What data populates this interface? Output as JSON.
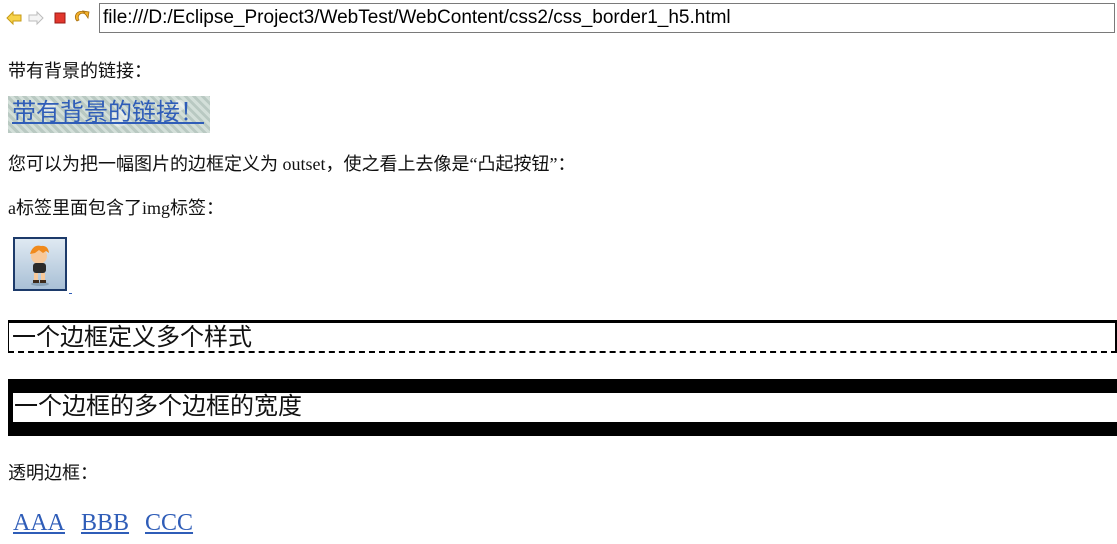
{
  "browser": {
    "url": "file:///D:/Eclipse_Project3/WebTest/WebContent/css2/css_border1_h5.html",
    "icons": [
      "back-icon",
      "forward-icon",
      "stop-icon",
      "refresh-icon"
    ]
  },
  "page": {
    "bg_link_caption": "带有背景的链接：",
    "bg_link_text": "带有背景的链接！",
    "outset_caption": "您可以为把一幅图片的边框定义为 outset，使之看上去像是“凸起按钮”：",
    "img_caption": "a标签里面包含了img标签：",
    "multi_style_text": "一个边框定义多个样式",
    "multi_width_text": "一个边框的多个边框的宽度",
    "transparent_caption": "透明边框：",
    "transparent_links": [
      "AAA",
      "BBB",
      "CCC"
    ]
  },
  "colors": {
    "link": "#2f5db8",
    "border": "#000000"
  }
}
